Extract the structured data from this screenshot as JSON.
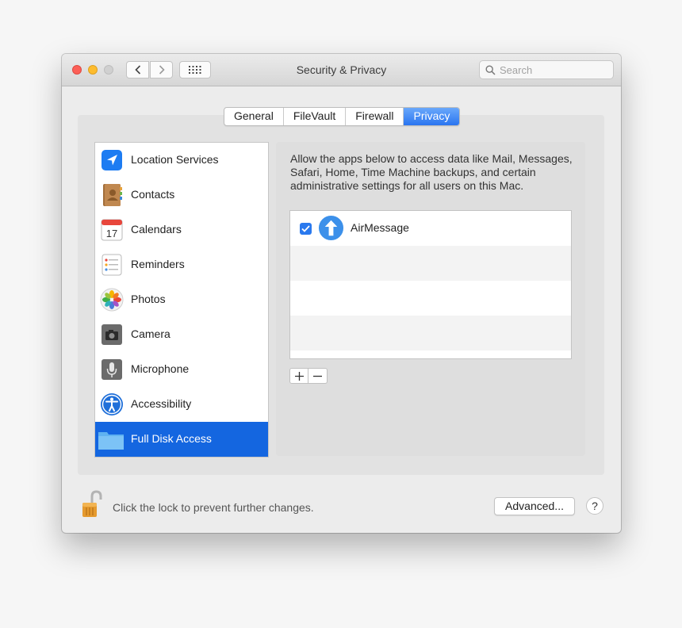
{
  "window": {
    "title": "Security & Privacy"
  },
  "search": {
    "placeholder": "Search"
  },
  "tabs": [
    {
      "label": "General"
    },
    {
      "label": "FileVault"
    },
    {
      "label": "Firewall"
    },
    {
      "label": "Privacy",
      "active": true
    }
  ],
  "sidebar": {
    "items": [
      {
        "label": "Location Services",
        "icon": "location-arrow-icon"
      },
      {
        "label": "Contacts",
        "icon": "contacts-book-icon"
      },
      {
        "label": "Calendars",
        "icon": "calendar-icon",
        "icon_text": "17"
      },
      {
        "label": "Reminders",
        "icon": "reminders-list-icon"
      },
      {
        "label": "Photos",
        "icon": "photos-flower-icon"
      },
      {
        "label": "Camera",
        "icon": "camera-icon"
      },
      {
        "label": "Microphone",
        "icon": "microphone-icon"
      },
      {
        "label": "Accessibility",
        "icon": "accessibility-icon"
      },
      {
        "label": "Full Disk Access",
        "icon": "folder-icon",
        "selected": true
      }
    ]
  },
  "privacy": {
    "description": "Allow the apps below to access data like Mail, Messages, Safari, Home, Time Machine backups, and certain administrative settings for all users on this Mac.",
    "apps": [
      {
        "name": "AirMessage",
        "checked": true,
        "icon": "airmessage-arrow-icon"
      }
    ]
  },
  "footer": {
    "lock_text": "Click the lock to prevent further changes.",
    "advanced_label": "Advanced...",
    "help_label": "?"
  },
  "colors": {
    "accent": "#1466e0",
    "tab_active": "#2a75f0",
    "checkbox": "#2a79ee"
  }
}
